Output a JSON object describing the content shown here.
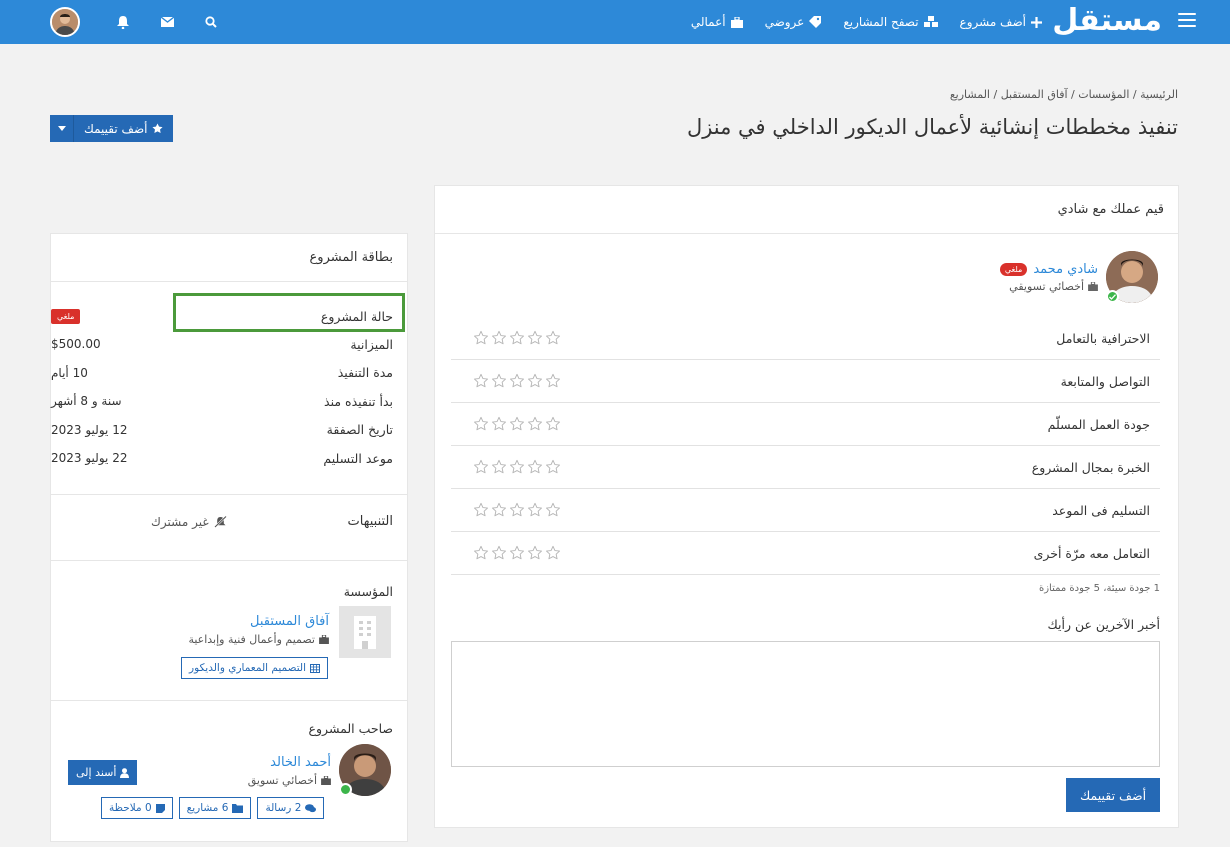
{
  "colors": {
    "primary": "#2d89d8",
    "button": "#2569b5",
    "danger": "#d9312b",
    "success": "#3cb54a",
    "highlight": "#4b9a3b"
  },
  "navbar": {
    "logo": "مستقل",
    "links": [
      {
        "label": "أضف مشروع",
        "icon": "plus-icon"
      },
      {
        "label": "تصفح المشاريع",
        "icon": "cubes-icon"
      },
      {
        "label": "عروضي",
        "icon": "tag-icon"
      },
      {
        "label": "أعمالي",
        "icon": "briefcase-icon"
      }
    ]
  },
  "breadcrumb": [
    "الرئيسية",
    "المؤسسات",
    "آفاق المستقبل",
    "المشاريع"
  ],
  "page_title": "تنفيذ مخططات إنشائية لأعمال الديكور الداخلي في منزل",
  "add_rating_button": "أضف تقييمك",
  "rating_panel": {
    "title": "قيم عملك مع شادي",
    "freelancer": {
      "name": "شادي محمد",
      "badge": "ملغي",
      "role": "أخصائي تسويقي"
    },
    "criteria": [
      "الاحترافية بالتعامل",
      "التواصل والمتابعة",
      "جودة العمل المسلّم",
      "الخبرة بمجال المشروع",
      "التسليم فى الموعد",
      "التعامل معه مرّة أخرى"
    ],
    "scale_hint": "1 جودة سيئة، 5 جودة ممتازة",
    "comment_label": "أخبر الآخرين عن رأيك",
    "comment_value": "",
    "submit_label": "أضف تقييمك"
  },
  "project_card": {
    "title": "بطاقة المشروع",
    "status_label": "حالة المشروع",
    "status_value": "ملغي",
    "rows": [
      {
        "k": "الميزانية",
        "v": "$500.00"
      },
      {
        "k": "مدة التنفيذ",
        "v": "10 أيام"
      },
      {
        "k": "بدأ تنفيذه منذ",
        "v": "سنة و 8 أشهر"
      },
      {
        "k": "تاريخ الصفقة",
        "v": "12 يوليو 2023"
      },
      {
        "k": "موعد التسليم",
        "v": "22 يوليو 2023"
      }
    ],
    "alerts_label": "التنبيهات",
    "alerts_value": "غير مشترك",
    "org_section": "المؤسسة",
    "org_name": "آفاق المستقبل",
    "org_desc": "تصميم وأعمال فنية وإبداعية",
    "org_category": "التصميم المعماري والديكور",
    "owner_section": "صاحب المشروع",
    "owner_name": "أحمد الخالد",
    "owner_role": "أخصائي تسويق",
    "assign_label": "أسند إلى",
    "owner_buttons": [
      "2 رسالة",
      "6 مشاريع",
      "0 ملاحظة"
    ]
  }
}
